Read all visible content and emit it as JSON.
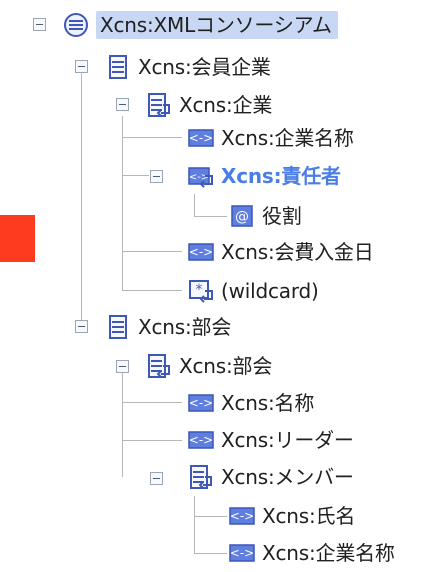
{
  "tree": {
    "nodes": [
      {
        "label": "Xcns:XMLコンソーシアム",
        "icon": "root-document-icon"
      },
      {
        "label": "Xcns:会員企業",
        "icon": "element-group-icon"
      },
      {
        "label": "Xcns:企業",
        "icon": "complex-element-icon"
      },
      {
        "label": "Xcns:企業名称",
        "icon": "simple-element-icon"
      },
      {
        "label": "Xcns:責任者",
        "icon": "complex-simple-element-icon"
      },
      {
        "label": "役割",
        "icon": "attribute-icon"
      },
      {
        "label": "Xcns:会費入金日",
        "icon": "simple-element-icon"
      },
      {
        "label": "(wildcard)",
        "icon": "wildcard-icon"
      },
      {
        "label": "Xcns:部会",
        "icon": "element-group-icon"
      },
      {
        "label": "Xcns:部会",
        "icon": "complex-element-icon"
      },
      {
        "label": "Xcns:名称",
        "icon": "simple-element-icon"
      },
      {
        "label": "Xcns:リーダー",
        "icon": "simple-element-icon"
      },
      {
        "label": "Xcns:メンバー",
        "icon": "complex-element-icon"
      },
      {
        "label": "Xcns:氏名",
        "icon": "simple-element-icon"
      },
      {
        "label": "Xcns:企業名称",
        "icon": "simple-element-icon"
      }
    ]
  },
  "colors": {
    "selection": "#c8d8f4",
    "emphasis": "#4a7ee6",
    "marker": "#ff3b1f"
  }
}
